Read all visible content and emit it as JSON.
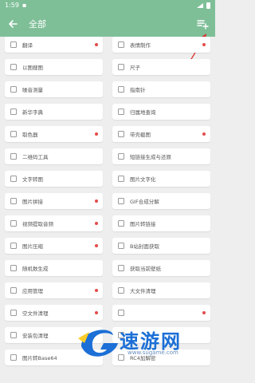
{
  "status": {
    "time": "1:59"
  },
  "appbar": {
    "title": "全部"
  },
  "tools": [
    {
      "label": "翻译",
      "icon": "translate-icon",
      "dot": true
    },
    {
      "label": "表情制作",
      "icon": "emoji-icon",
      "dot": true
    },
    {
      "label": "以图搜图",
      "icon": "image-search-icon",
      "dot": false
    },
    {
      "label": "尺子",
      "icon": "ruler-icon",
      "dot": false
    },
    {
      "label": "噪音测量",
      "icon": "noise-meter-icon",
      "dot": false
    },
    {
      "label": "指南针",
      "icon": "compass-icon",
      "dot": false
    },
    {
      "label": "新华字典",
      "icon": "dictionary-icon",
      "dot": false
    },
    {
      "label": "归属地查询",
      "icon": "location-icon",
      "dot": false
    },
    {
      "label": "取色器",
      "icon": "color-picker-icon",
      "dot": true
    },
    {
      "label": "带壳截图",
      "icon": "phone-frame-icon",
      "dot": true
    },
    {
      "label": "二维码工具",
      "icon": "qrcode-icon",
      "dot": false
    },
    {
      "label": "短链接生成与还原",
      "icon": "link-icon",
      "dot": false
    },
    {
      "label": "文字转图",
      "icon": "text-to-image-icon",
      "dot": false
    },
    {
      "label": "图片文字化",
      "icon": "image-text-icon",
      "dot": false
    },
    {
      "label": "图片拼接",
      "icon": "image-stitch-icon",
      "dot": true
    },
    {
      "label": "GIF合成分解",
      "icon": "gif-icon",
      "dot": false
    },
    {
      "label": "视频提取音频",
      "icon": "video-audio-icon",
      "dot": true
    },
    {
      "label": "图片转链接",
      "icon": "image-link-icon",
      "dot": false
    },
    {
      "label": "图片压缩",
      "icon": "image-compress-icon",
      "dot": true
    },
    {
      "label": "B站封面获取",
      "icon": "bilibili-icon",
      "dot": false
    },
    {
      "label": "随机数生成",
      "icon": "dice-icon",
      "dot": false
    },
    {
      "label": "获取当前壁纸",
      "icon": "wallpaper-icon",
      "dot": false
    },
    {
      "label": "应用管理",
      "icon": "apps-icon",
      "dot": true
    },
    {
      "label": "大文件清理",
      "icon": "trash-icon",
      "dot": false
    },
    {
      "label": "空文件清理",
      "icon": "clean-icon",
      "dot": true
    },
    {
      "label": "",
      "icon": "hidden-icon",
      "dot": true
    },
    {
      "label": "安装包清理",
      "icon": "package-icon",
      "dot": false
    },
    {
      "label": "",
      "icon": "hidden-icon",
      "dot": false
    },
    {
      "label": "图片转Base64",
      "icon": "base64-icon",
      "dot": false
    },
    {
      "label": "RC4加解密",
      "icon": "lock-icon",
      "dot": false
    }
  ],
  "watermark": {
    "text": "速游网",
    "url": "www.sugame.com"
  },
  "colors": {
    "appbar": "#7fbf98",
    "dot": "#e34b4b",
    "background": "#eeeeee",
    "watermark": "#1b6fd6"
  }
}
